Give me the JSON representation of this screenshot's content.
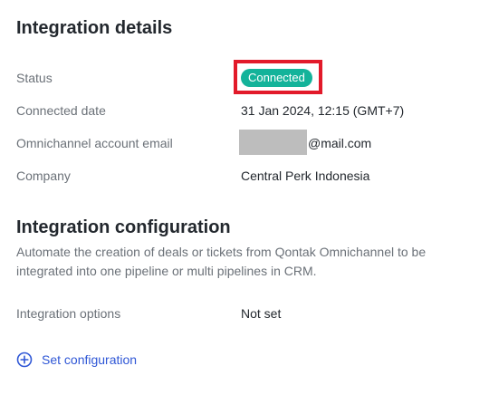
{
  "details": {
    "title": "Integration details",
    "status_label": "Status",
    "status_value": "Connected",
    "connected_date_label": "Connected date",
    "connected_date_value": "31 Jan 2024, 12:15 (GMT+7)",
    "email_label": "Omnichannel account email",
    "email_value_visible": "@mail.com",
    "company_label": "Company",
    "company_value": "Central Perk Indonesia"
  },
  "config": {
    "title": "Integration configuration",
    "description": "Automate the creation of deals or tickets from Qontak Omnichannel to be integrated into one pipeline or multi pipelines in CRM.",
    "options_label": "Integration options",
    "options_value": "Not set",
    "action_label": "Set configuration",
    "action_icon": "plus-circle-icon"
  },
  "colors": {
    "status_badge": "#14b39a",
    "highlight_border": "#e21a2a",
    "link": "#2f57d6",
    "redaction": "#bdbdbd"
  }
}
